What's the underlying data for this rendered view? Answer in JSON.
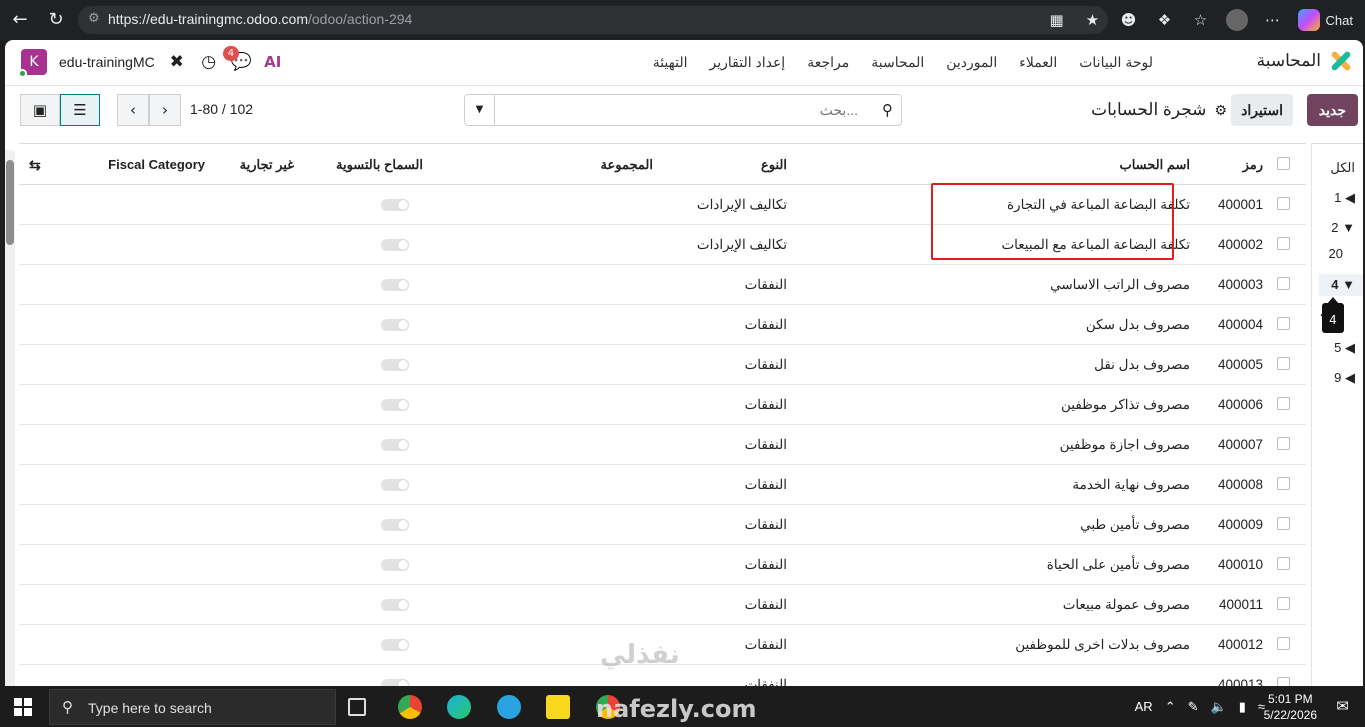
{
  "browser": {
    "url_host": "https://edu-trainingmc.odoo.com",
    "url_path": "/odoo/action-294",
    "chat_label": "Chat"
  },
  "topbar": {
    "brand": "المحاسبة",
    "menu": [
      "لوحة البيانات",
      "العملاء",
      "الموردين",
      "المحاسبة",
      "مراجعة",
      "إعداد التقارير",
      "التهيئة"
    ],
    "db_name": "edu-trainingMC",
    "avatar_letter": "K",
    "messages_badge": "4"
  },
  "control": {
    "new_label": "جديد",
    "import_label": "استيراد",
    "title": "شجرة الحسابات",
    "search_placeholder": "بحث...",
    "pager": "1-80 / 102"
  },
  "table": {
    "headers": {
      "code": "رمز",
      "name": "اسم الحساب",
      "type": "النوع",
      "group": "المجموعة",
      "reconcile": "السماح بالتسوية",
      "non_trade": "غير تجارية",
      "fiscal": "Fiscal Category"
    },
    "rows": [
      {
        "code": "400001",
        "name": "تكلفة البضاعة المباعة في التجارة",
        "type": "تكاليف الإيرادات"
      },
      {
        "code": "400002",
        "name": "تكلفة البضاعة المباعة مع المبيعات",
        "type": "تكاليف الإيرادات"
      },
      {
        "code": "400003",
        "name": "مصروف الراتب الاساسي",
        "type": "النفقات"
      },
      {
        "code": "400004",
        "name": "مصروف بدل سكن",
        "type": "النفقات"
      },
      {
        "code": "400005",
        "name": "مصروف بدل نقل",
        "type": "النفقات"
      },
      {
        "code": "400006",
        "name": "مصروف تذاكر موظفين",
        "type": "النفقات"
      },
      {
        "code": "400007",
        "name": "مصروف اجازة موظفين",
        "type": "النفقات"
      },
      {
        "code": "400008",
        "name": "مصروف نهاية الخدمة",
        "type": "النفقات"
      },
      {
        "code": "400009",
        "name": "مصروف تأمين طبي",
        "type": "النفقات"
      },
      {
        "code": "400010",
        "name": "مصروف تأمين على الحياة",
        "type": "النفقات"
      },
      {
        "code": "400011",
        "name": "مصروف عمولة مبيعات",
        "type": "النفقات"
      },
      {
        "code": "400012",
        "name": "مصروف بدلات اخرى للموظفين",
        "type": "النفقات"
      },
      {
        "code": "400013",
        "name": "",
        "type": "النفقات"
      }
    ]
  },
  "sidepanel": {
    "items": [
      "الكل",
      "1",
      "2",
      "20",
      "4",
      "40",
      "5",
      "9"
    ],
    "tooltip": "4"
  },
  "taskbar": {
    "search_placeholder": "Type here to search",
    "lang": "AR",
    "time": "5:01 PM",
    "date": "5/22/2026"
  },
  "watermarks": {
    "top": "نفذلي",
    "bottom": "nafezly.com"
  },
  "colors": {
    "primary": "#71435f",
    "highlight": "#e01e1e",
    "teal": "#017e84"
  }
}
